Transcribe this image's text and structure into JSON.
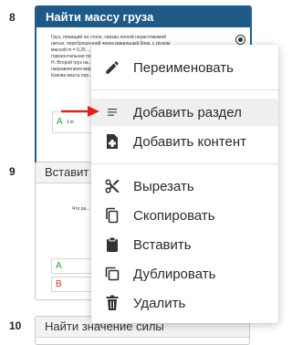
{
  "slides": [
    {
      "number": "8",
      "title": "Найти массу груза",
      "body_lines": [
        "Груз, лежащий на столе, связан легкой нерастяжимой",
        "нитью, переброшенной через идеальный блок, с грузом",
        "массой m = 0,25 ...",
        "горизонтальная по...",
        "H. Второй груз на...",
        "направлением вер...",
        "Какова масса пер..."
      ],
      "answer_a": "A",
      "answer_a_value": "1 кг"
    },
    {
      "number": "9",
      "title": "Вставит",
      "body_text": "Что ра...",
      "answer_a": "A",
      "answer_b": "B"
    },
    {
      "number": "10",
      "title": "Найти значение силы"
    }
  ],
  "context_menu": {
    "items": [
      {
        "label": "Переименовать",
        "icon": "pencil-icon"
      },
      {
        "label": "Добавить раздел",
        "icon": "lines-icon"
      },
      {
        "label": "Добавить контент",
        "icon": "add-content-icon"
      },
      {
        "label": "Вырезать",
        "icon": "scissors-icon"
      },
      {
        "label": "Скопировать",
        "icon": "copy-icon"
      },
      {
        "label": "Вставить",
        "icon": "clipboard-icon"
      },
      {
        "label": "Дублировать",
        "icon": "duplicate-icon"
      },
      {
        "label": "Удалить",
        "icon": "trash-icon"
      }
    ],
    "highlighted_item": "Добавить раздел"
  },
  "colors": {
    "active_header": "#1f5a86",
    "arrow": "#e0201b",
    "menu_highlight": "#efefef"
  }
}
